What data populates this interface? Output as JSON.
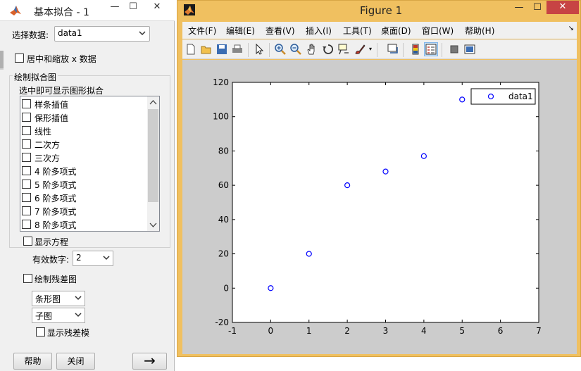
{
  "fit_window": {
    "title": "基本拟合 - 1",
    "minimize_glyph": "—",
    "maximize_glyph": "☐",
    "close_glyph": "✕",
    "select_data_label": "选择数据:",
    "select_data_value": "data1",
    "center_scale_label": "居中和缩放 x 数据",
    "plot_fits_title": "绘制拟合图",
    "check_to_display_label": "选中即可显示图形拟合",
    "fit_types": [
      {
        "label": "样条插值"
      },
      {
        "label": "保形插值"
      },
      {
        "label": "线性"
      },
      {
        "label": "二次方"
      },
      {
        "label": "三次方"
      },
      {
        "label": "4 阶多项式"
      },
      {
        "label": "5 阶多项式"
      },
      {
        "label": "6 阶多项式"
      },
      {
        "label": "7 阶多项式"
      },
      {
        "label": "8 阶多项式"
      }
    ],
    "show_equations_label": "显示方程",
    "significant_digits_label": "有效数字:",
    "significant_digits_value": "2",
    "plot_residuals_label": "绘制残差图",
    "residual_plot_type": "条形图",
    "residual_plot_location": "子图",
    "show_residual_norm_label": "显示残差模",
    "help_button": "帮助",
    "close_button": "关闭",
    "next_arrow": "→"
  },
  "figure_window": {
    "title": "Figure 1",
    "minimize_glyph": "—",
    "maximize_glyph": "☐",
    "close_glyph": "✕",
    "menu": [
      "文件(F)",
      "编辑(E)",
      "查看(V)",
      "插入(I)",
      "工具(T)",
      "桌面(D)",
      "窗口(W)",
      "帮助(H)"
    ],
    "menu_overflow": "↘",
    "toolbar_icons": [
      "new-figure-icon",
      "open-file-icon",
      "save-icon",
      "print-icon",
      "select-arrow-icon",
      "zoom-in-icon",
      "zoom-out-icon",
      "pan-hand-icon",
      "rotate-3d-icon",
      "data-cursor-icon",
      "brush-icon",
      "link-plot-icon",
      "colorbar-icon",
      "legend-icon",
      "hide-plot-tools-icon",
      "show-plot-tools-icon"
    ]
  },
  "colors": {
    "figure_frame": "#f0c060",
    "canvas_bg": "#cccccc",
    "marker": "#0000ff",
    "close_red": "#c74444"
  },
  "chart_data": {
    "type": "scatter",
    "series": [
      {
        "name": "data1",
        "marker": "o",
        "x": [
          0,
          1,
          2,
          3,
          4,
          5
        ],
        "y": [
          0,
          20,
          60,
          68,
          77,
          110
        ]
      }
    ],
    "xlim": [
      -1,
      7
    ],
    "ylim": [
      -20,
      120
    ],
    "xticks": [
      -1,
      0,
      1,
      2,
      3,
      4,
      5,
      6,
      7
    ],
    "yticks": [
      -20,
      0,
      20,
      40,
      60,
      80,
      100,
      120
    ],
    "grid": false,
    "legend_position": "top-right",
    "title": "",
    "xlabel": "",
    "ylabel": ""
  }
}
